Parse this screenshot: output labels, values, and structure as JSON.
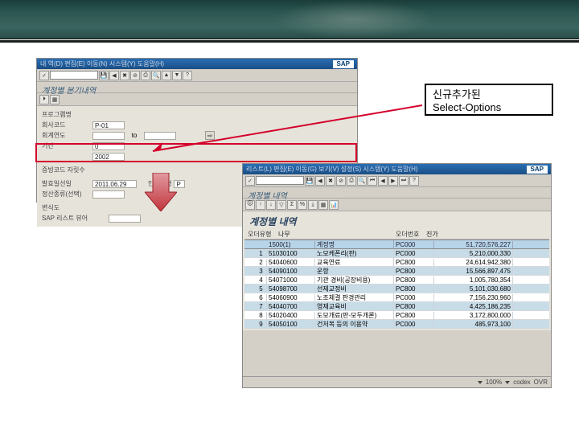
{
  "annotation": {
    "line1": "신규추가된",
    "line2": "Select-Options"
  },
  "win1": {
    "menu": "내 역(D)  편집(E)  이동(N)  시스템(Y)  도움말(H)",
    "sap": "SAP",
    "screen_title": "계정별 본기내역",
    "labels": {
      "program": "프로그램명",
      "cocode": "회사코드",
      "fiyear": "회계연도",
      "month": "기간",
      "year": "",
      "chart": "증빙코드 자릿수",
      "keydate": "발효일선일",
      "account": "정산종류(선택)",
      "variant": "변식도",
      "sap_list": "SAP 리스트 뷰어"
    },
    "values": {
      "cocode": "P-01",
      "fiyear_from": "",
      "fiyear_to": "",
      "month": "0",
      "year": "2002",
      "keydate": "2011.06.29",
      "account": "",
      "midlabel": "인증유형",
      "midval": "P"
    },
    "to": "to"
  },
  "win2": {
    "menu": "리스트(L)  편집(E)  이동(G)  보기(V)  설정(S)  시스템(Y)  도움말(H)",
    "sap": "SAP",
    "screen_title": "계정별 내역",
    "grid_title": "계정별 내역",
    "sub": {
      "l1": "오더유형",
      "v1": "나무",
      "l2": "오더번호",
      "v2": "진가"
    },
    "cols": {
      "idx": "",
      "acc": "1500(1)",
      "txt": "계정명",
      "cost": "PC000",
      "amt": "51,720,576,227"
    },
    "rows": [
      {
        "idx": "1",
        "acc": "51030100",
        "txt": "노모케폰리(판)",
        "cost": "PC000",
        "amt": "5,210,000,330"
      },
      {
        "idx": "2",
        "acc": "54040600",
        "txt": "교육연료",
        "cost": "PC800",
        "amt": "24,614,942,380"
      },
      {
        "idx": "3",
        "acc": "54090100",
        "txt": "운항",
        "cost": "PC800",
        "amt": "15,566,897,475"
      },
      {
        "idx": "4",
        "acc": "54071000",
        "txt": "기관 경비(공장비용)",
        "cost": "PC800",
        "amt": "1,005,780,354"
      },
      {
        "idx": "5",
        "acc": "54098700",
        "txt": "선제교정비",
        "cost": "PC800",
        "amt": "5,101,030,680"
      },
      {
        "idx": "6",
        "acc": "54060900",
        "txt": "노조체결 판경관리",
        "cost": "PC000",
        "amt": "7,156,230,960"
      },
      {
        "idx": "7",
        "acc": "54040700",
        "txt": "영재교육비",
        "cost": "PC800",
        "amt": "4,425,186,235"
      },
      {
        "idx": "8",
        "acc": "54020400",
        "txt": "도모개료(판-모두개론)",
        "cost": "PC800",
        "amt": "3,172,800,000"
      },
      {
        "idx": "9",
        "acc": "54050100",
        "txt": "건저복 등의 이용약",
        "cost": "PC000",
        "amt": "485,973,100"
      }
    ],
    "status": {
      "zoom": "100%",
      "client": "codex",
      "server": "OVR"
    }
  }
}
